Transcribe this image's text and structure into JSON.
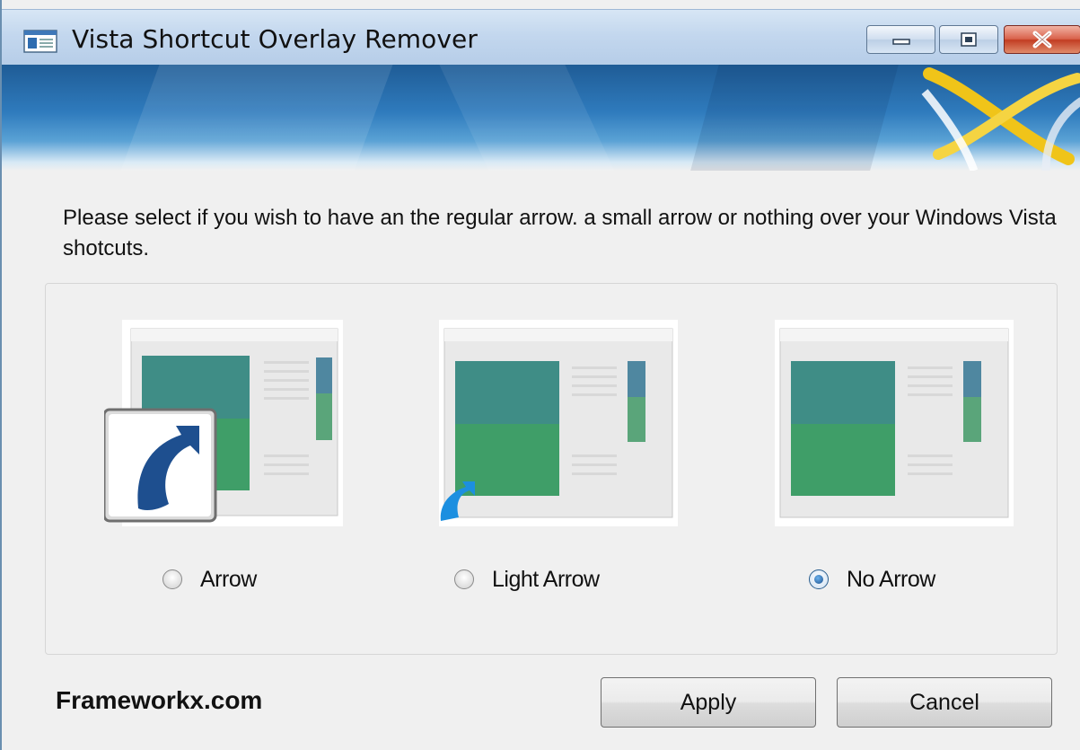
{
  "window": {
    "title": "Vista Shortcut Overlay Remover",
    "controls": [
      "minimize",
      "maximize",
      "close"
    ]
  },
  "description": "Please select if you wish to have an the regular arrow. a small arrow or nothing over your Windows Vista shotcuts.",
  "options": [
    {
      "label": "Arrow",
      "selected": false,
      "overlay": "large-shortcut-arrow"
    },
    {
      "label": "Light Arrow",
      "selected": false,
      "overlay": "small-shortcut-arrow"
    },
    {
      "label": "No Arrow",
      "selected": true,
      "overlay": "none"
    }
  ],
  "footer": {
    "brand": "Frameworkx.com",
    "apply_label": "Apply",
    "cancel_label": "Cancel"
  },
  "colors": {
    "titlebar": "#c3d7ee",
    "banner": "#2f7bbd",
    "dialog_bg": "#f0f0f0",
    "shortcut_arrow": "#1a4f8c"
  }
}
